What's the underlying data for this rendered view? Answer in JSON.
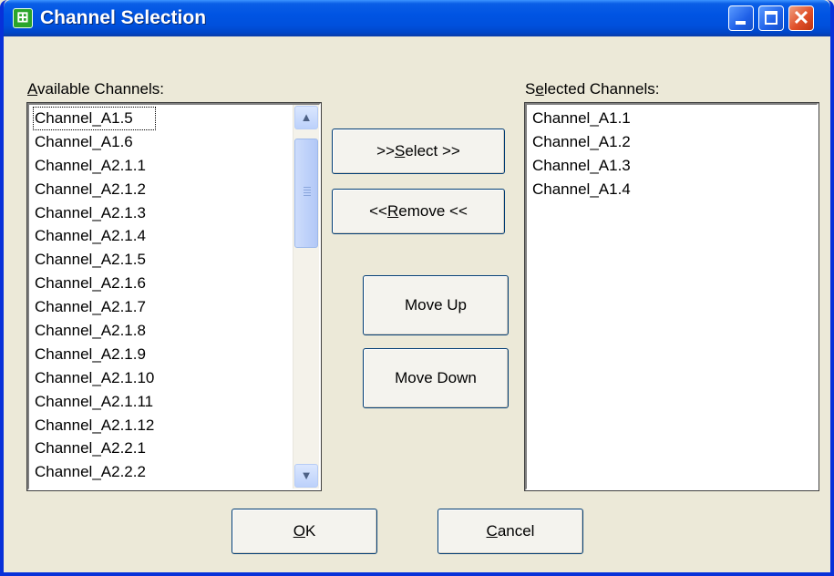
{
  "window": {
    "title": "Channel Selection",
    "icon": "app-icon",
    "min_icon": "minimize-icon",
    "max_icon": "maximize-icon",
    "close_icon": "close-icon"
  },
  "available": {
    "label_prefix": "",
    "label_accel": "A",
    "label_rest": "vailable Channels:",
    "items": [
      "Channel_A1.5",
      "Channel_A1.6",
      "Channel_A2.1.1",
      "Channel_A2.1.2",
      "Channel_A2.1.3",
      "Channel_A2.1.4",
      "Channel_A2.1.5",
      "Channel_A2.1.6",
      "Channel_A2.1.7",
      "Channel_A2.1.8",
      "Channel_A2.1.9",
      "Channel_A2.1.10",
      "Channel_A2.1.11",
      "Channel_A2.1.12",
      "Channel_A2.2.1",
      "Channel_A2.2.2"
    ],
    "focused_index": 0
  },
  "selected": {
    "label_prefix": "S",
    "label_accel": "e",
    "label_rest": "lected Channels:",
    "items": [
      "Channel_A1.1",
      "Channel_A1.2",
      "Channel_A1.3",
      "Channel_A1.4"
    ]
  },
  "buttons": {
    "select": {
      "prefix": ">> ",
      "accel": "S",
      "rest": "elect >>"
    },
    "remove": {
      "prefix": "<< ",
      "accel": "R",
      "rest": "emove <<"
    },
    "move_up": "Move Up",
    "move_down": "Move Down",
    "ok": {
      "prefix": "",
      "accel": "O",
      "rest": "K"
    },
    "cancel": {
      "prefix": "",
      "accel": "C",
      "rest": "ancel"
    }
  },
  "colors": {
    "titlebar": "#0054e3",
    "dialog_bg": "#ece9d8",
    "list_bg": "#ffffff"
  }
}
